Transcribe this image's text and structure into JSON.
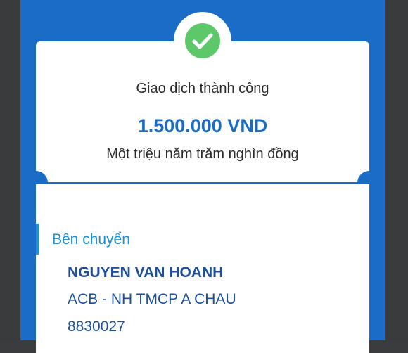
{
  "receipt": {
    "status": "Giao dịch thành công",
    "amount": "1.500.000 VND",
    "amount_in_words": "Một triệu năm trăm nghìn đồng",
    "success_icon": "checkmark-icon"
  },
  "sender": {
    "section_title": "Bên chuyển",
    "name": "NGUYEN VAN HOANH",
    "bank": "ACB - NH TMCP A CHAU",
    "account": "8830027"
  },
  "colors": {
    "accent_blue": "#1b6cc6",
    "success_green": "#5dc86a",
    "section_blue": "#1b8fd8",
    "text_navy": "#1d4f9c"
  }
}
